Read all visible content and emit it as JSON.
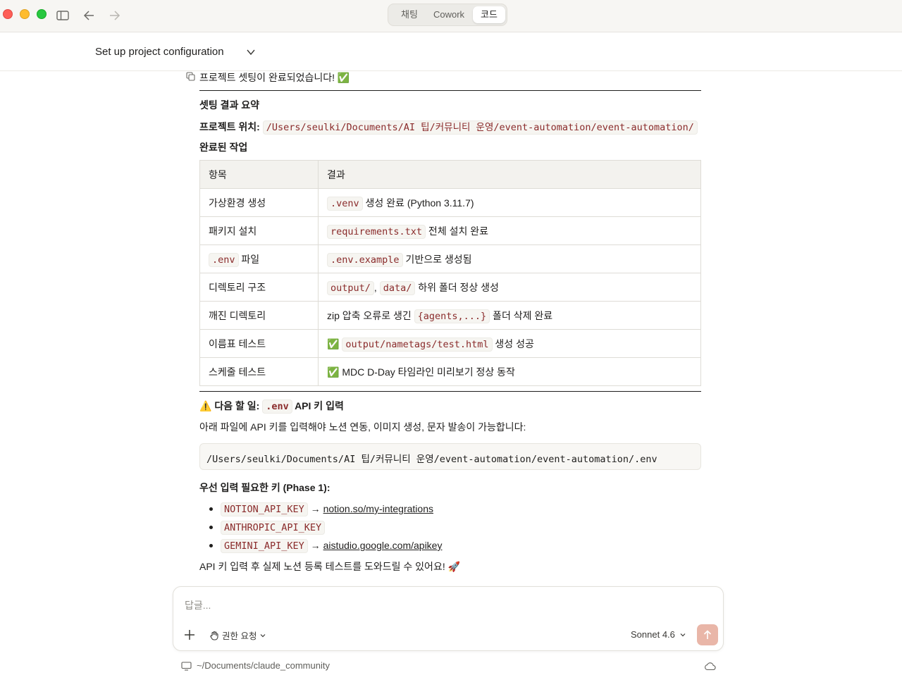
{
  "titlebar": {
    "modes": [
      "채팅",
      "Cowork",
      "코드"
    ],
    "active_mode": "코드"
  },
  "header": {
    "title": "Set up project configuration"
  },
  "message": {
    "intro": "프로젝트 셋팅이 완료되었습니다! ✅",
    "summary_heading": "셋팅 결과 요약",
    "location_label": "프로젝트 위치:",
    "location_path": "/Users/seulki/Documents/AI 팁/커뮤니티 운영/event-automation/event-automation/",
    "done_heading": "완료된 작업",
    "table": {
      "headers": [
        "항목",
        "결과"
      ],
      "rows": [
        {
          "item": "가상환경 생성",
          "code1": ".venv",
          "sep": "",
          "code2": "",
          "pre": "",
          "text": " 생성 완료 (Python 3.11.7)"
        },
        {
          "item": "패키지 설치",
          "code1": "requirements.txt",
          "sep": "",
          "code2": "",
          "pre": "",
          "text": " 전체 설치 완료"
        },
        {
          "item_code": ".env",
          "item": " 파일",
          "code1": ".env.example",
          "sep": "",
          "code2": "",
          "pre": "",
          "text": " 기반으로 생성됨"
        },
        {
          "item": "디렉토리 구조",
          "code1": "output/",
          "sep": ", ",
          "code2": "data/",
          "pre": "",
          "text": " 하위 폴더 정상 생성"
        },
        {
          "item": "깨진 디렉토리",
          "pre": "zip 압축 오류로 생긴 ",
          "code1": "{agents,...}",
          "sep": "",
          "code2": "",
          "text": " 폴더 삭제 완료"
        },
        {
          "item": "이름표 테스트",
          "pre": "✅ ",
          "code1": "output/nametags/test.html",
          "sep": "",
          "code2": "",
          "text": " 생성 성공"
        },
        {
          "item": "스케줄 테스트",
          "pre": "✅ MDC D-Day 타임라인 미리보기 정상 동작",
          "code1": "",
          "sep": "",
          "code2": "",
          "text": ""
        }
      ]
    },
    "next_prefix": "⚠️ 다음 할 일: ",
    "next_code": ".env",
    "next_suffix": " API 키 입력",
    "explain": "아래 파일에 API 키를 입력해야 노션 연동, 이미지 생성, 문자 발송이 가능합니다:",
    "env_path": "/Users/seulki/Documents/AI 팁/커뮤니티 운영/event-automation/event-automation/.env",
    "priority_heading": "우선 입력 필요한 키 (Phase 1):",
    "keys": [
      {
        "name": "NOTION_API_KEY",
        "arrow": " → ",
        "link": "notion.so/my-integrations"
      },
      {
        "name": "ANTHROPIC_API_KEY",
        "arrow": "",
        "link": ""
      },
      {
        "name": "GEMINI_API_KEY",
        "arrow": " → ",
        "link": "aistudio.google.com/apikey"
      }
    ],
    "closing": "API 키 입력 후 실제 노션 등록 테스트를 도와드릴 수 있어요! 🚀"
  },
  "composer": {
    "placeholder": "답글...",
    "permission_label": "권한 요청",
    "model_label": "Sonnet 4.6"
  },
  "footer": {
    "path": "~/Documents/claude_community"
  },
  "colors": {
    "accent_send": "#e9b6a8",
    "code_text": "#8a2b2b"
  }
}
